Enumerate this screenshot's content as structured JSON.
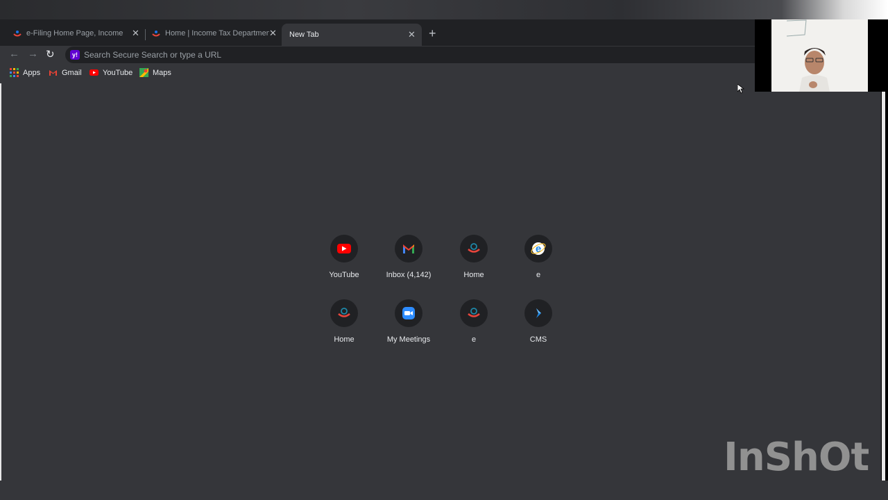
{
  "browser": {
    "tabs": [
      {
        "title": "e-Filing Home Page, Income Tax",
        "active": false
      },
      {
        "title": "Home | Income Tax Department",
        "active": false
      },
      {
        "title": "New Tab",
        "active": true
      }
    ],
    "close_glyph": "✕",
    "new_tab_glyph": "+",
    "omnibox": {
      "placeholder": "Search Secure Search or type a URL",
      "engine_icon_text": "y!"
    },
    "bookmarks": [
      {
        "label": "Apps",
        "icon": "apps-grid-icon"
      },
      {
        "label": "Gmail",
        "icon": "gmail-icon"
      },
      {
        "label": "YouTube",
        "icon": "youtube-icon"
      },
      {
        "label": "Maps",
        "icon": "maps-icon"
      }
    ]
  },
  "shortcuts": [
    {
      "label": "YouTube",
      "icon": "youtube-icon"
    },
    {
      "label": "Inbox (4,142)",
      "icon": "gmail-icon"
    },
    {
      "label": "Home",
      "icon": "incometax-logo-icon"
    },
    {
      "label": "e",
      "icon": "internet-explorer-icon"
    },
    {
      "label": "Home",
      "icon": "incometax-logo-icon"
    },
    {
      "label": "My Meetings",
      "icon": "zoom-icon"
    },
    {
      "label": "e",
      "icon": "incometax-logo-icon"
    },
    {
      "label": "CMS",
      "icon": "cms-icon"
    }
  ],
  "watermark": "InShOt",
  "colors": {
    "chrome_dark": "#202124",
    "page_bg": "#35363a",
    "text": "#e8eaed",
    "youtube_red": "#ff0000",
    "yahoo_purple": "#6001d2",
    "zoom_blue": "#2d8cff"
  }
}
